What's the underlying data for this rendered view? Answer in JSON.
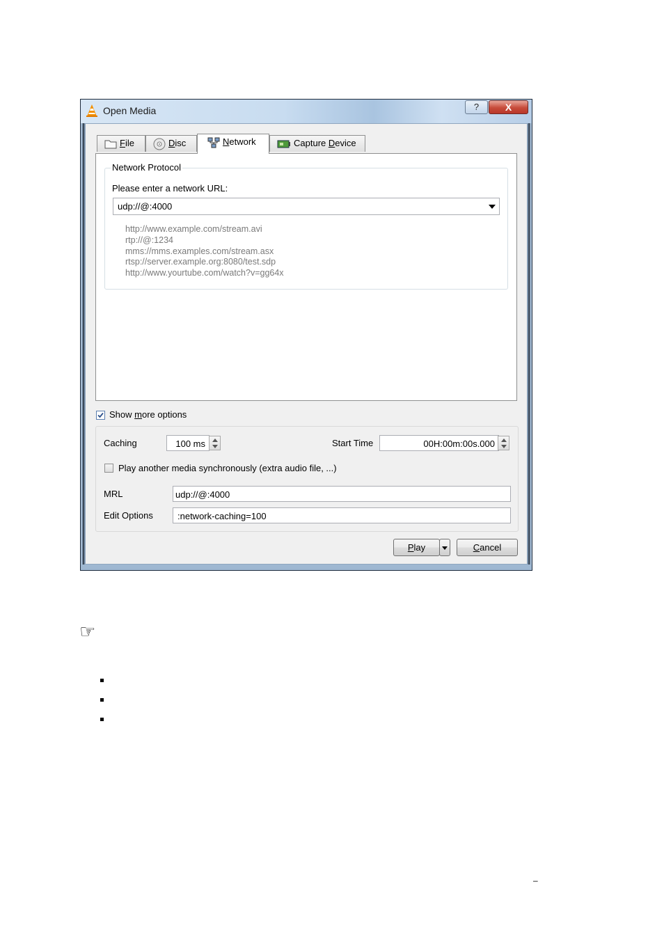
{
  "window": {
    "title": "Open Media",
    "help_label": "?",
    "close_label": "X"
  },
  "tabs": [
    {
      "label_pre": "",
      "accel": "F",
      "label_post": "ile",
      "icon": "folder-icon",
      "active": false
    },
    {
      "label_pre": "",
      "accel": "D",
      "label_post": "isc",
      "icon": "disc-icon",
      "active": false
    },
    {
      "label_pre": "",
      "accel": "N",
      "label_post": "etwork",
      "icon": "network-icon",
      "active": true
    },
    {
      "label_pre": "Capture ",
      "accel": "D",
      "label_post": "evice",
      "icon": "capture-card-icon",
      "active": false
    }
  ],
  "network": {
    "group_title": "Network Protocol",
    "prompt": "Please enter a network URL:",
    "url_value": "udp://@:4000",
    "examples": [
      "http://www.example.com/stream.avi",
      "rtp://@:1234",
      "mms://mms.examples.com/stream.asx",
      "rtsp://server.example.org:8080/test.sdp",
      "http://www.yourtube.com/watch?v=gg64x"
    ]
  },
  "options": {
    "show_more_pre": "Show ",
    "show_more_accel": "m",
    "show_more_post": "ore options",
    "show_more_checked": true,
    "caching_label": "Caching",
    "caching_value": "100 ms",
    "start_time_label": "Start Time",
    "start_time_value": "00H:00m:00s.000",
    "sync_label": "Play another media synchronously (extra audio file, ...)",
    "sync_checked": false,
    "mrl_label": "MRL",
    "mrl_value": "udp://@:4000",
    "edit_options_label": "Edit Options",
    "edit_options_value": ":network-caching=100"
  },
  "buttons": {
    "play_accel": "P",
    "play_rest": "lay",
    "cancel_accel": "C",
    "cancel_rest": "ancel"
  },
  "page": {
    "note_icon": "pointing-hand-icon",
    "bullet_count": 3,
    "footer_mark": "–"
  }
}
